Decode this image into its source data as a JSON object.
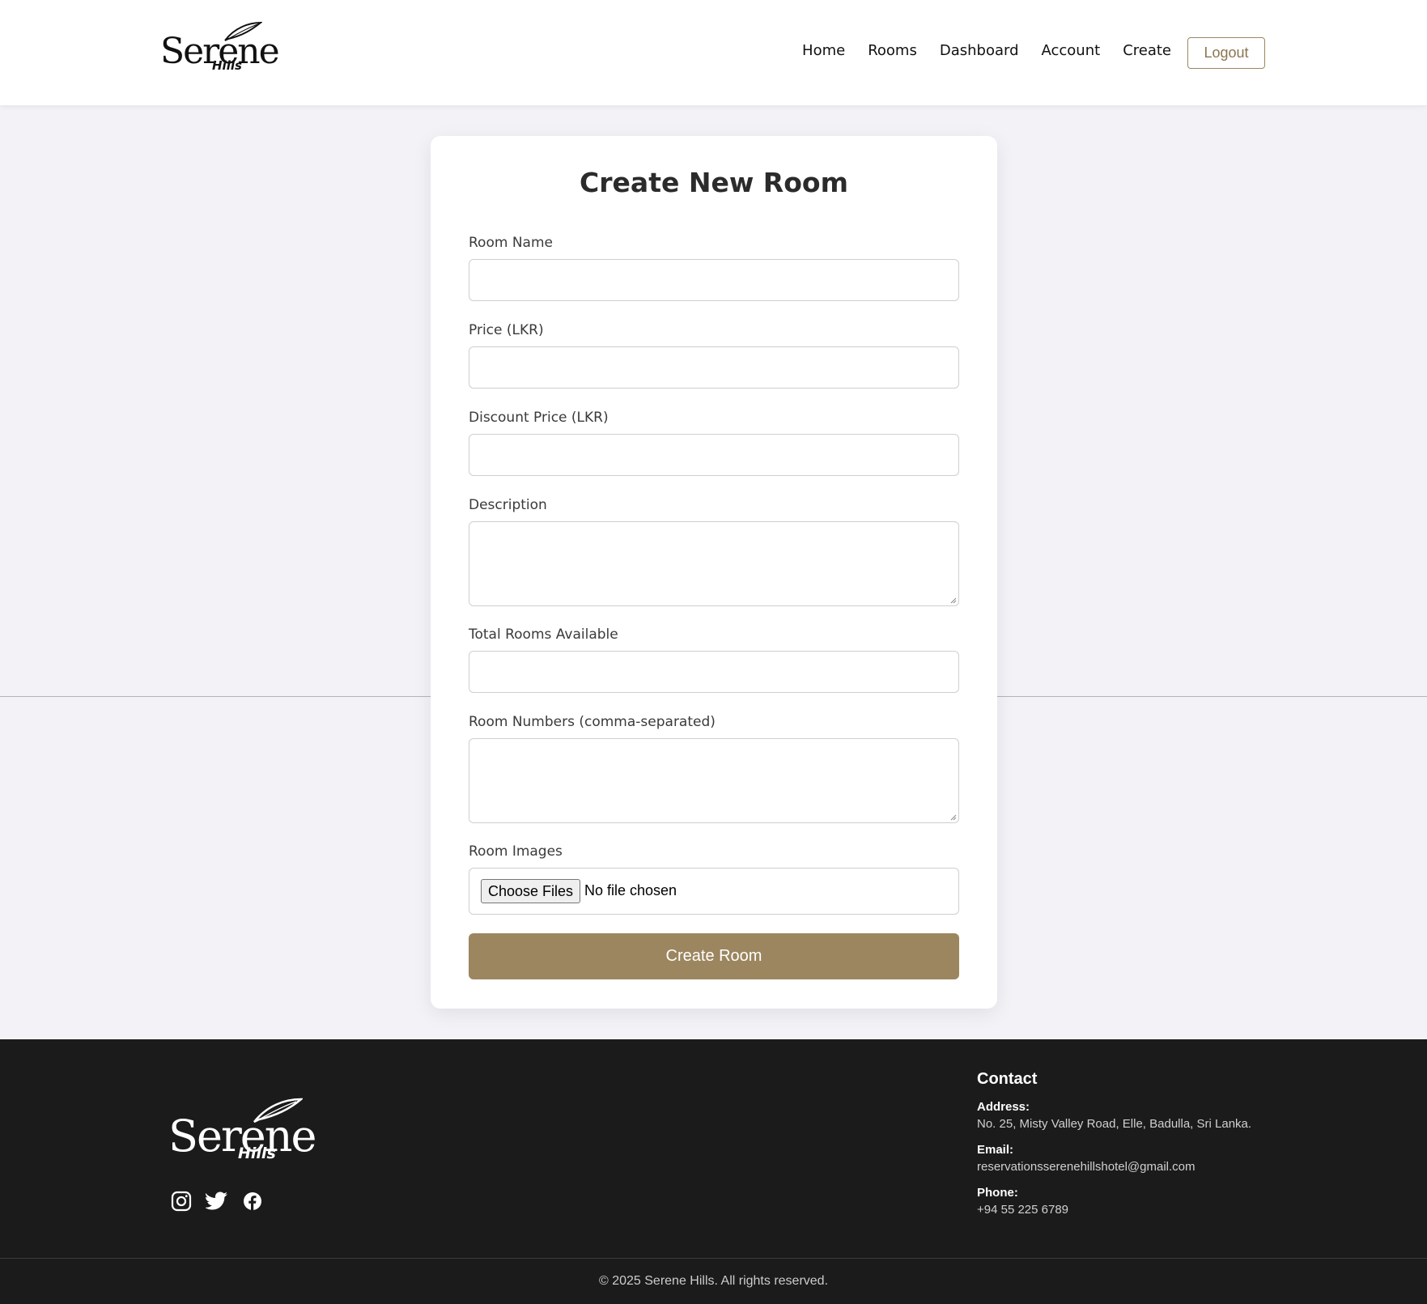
{
  "brand": {
    "name": "Serene",
    "sub": "Hills",
    "accent": "#9c865f"
  },
  "nav": {
    "items": [
      {
        "label": "Home"
      },
      {
        "label": "Rooms"
      },
      {
        "label": "Dashboard"
      },
      {
        "label": "Account"
      },
      {
        "label": "Create"
      }
    ],
    "logout_label": "Logout"
  },
  "form": {
    "title": "Create New Room",
    "fields": {
      "room_name": {
        "label": "Room Name",
        "value": ""
      },
      "price": {
        "label": "Price (LKR)",
        "value": ""
      },
      "discount_price": {
        "label": "Discount Price (LKR)",
        "value": ""
      },
      "description": {
        "label": "Description",
        "value": ""
      },
      "total_rooms": {
        "label": "Total Rooms Available",
        "value": ""
      },
      "room_numbers": {
        "label": "Room Numbers (comma-separated)",
        "value": ""
      },
      "room_images": {
        "label": "Room Images",
        "button": "Choose Files",
        "status": "No file chosen"
      }
    },
    "submit_label": "Create Room"
  },
  "footer": {
    "social": [
      "instagram-icon",
      "twitter-icon",
      "facebook-icon"
    ],
    "contact": {
      "heading": "Contact",
      "address_label": "Address:",
      "address": "No. 25, Misty Valley Road, Elle, Badulla, Sri Lanka.",
      "email_label": "Email:",
      "email": "reservationsserenehillshotel@gmail.com",
      "phone_label": "Phone:",
      "phone": "+94 55 225 6789"
    },
    "copyright": "© 2025 Serene Hills. All rights reserved."
  }
}
